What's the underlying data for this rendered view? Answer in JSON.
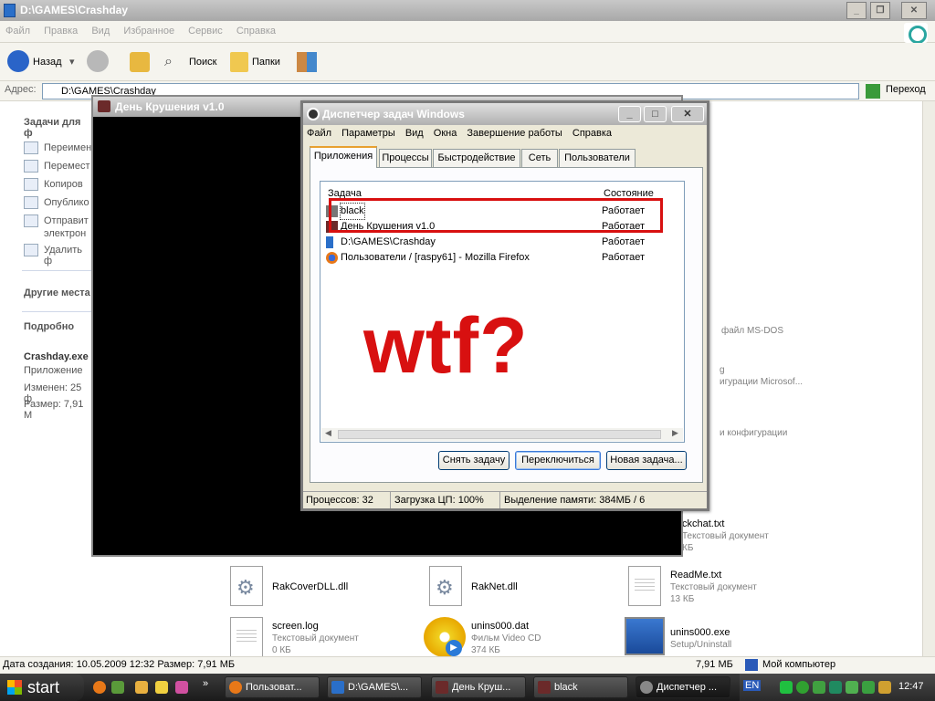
{
  "explorer": {
    "title": "D:\\GAMES\\Crashday",
    "menu": [
      "Файл",
      "Правка",
      "Вид",
      "Избранное",
      "Сервис",
      "Справка"
    ],
    "toolbar": {
      "back": "Назад",
      "search": "Поиск",
      "folders": "Папки"
    },
    "address_label": "Адрес:",
    "address_value": "D:\\GAMES\\Crashday",
    "go": "Переход",
    "taskpane": {
      "tasks_header": "Задачи для ф",
      "tasks": [
        "Переимен",
        "Перемест",
        "Копиров",
        "Опублико",
        "Отправит",
        "электрон",
        "Удалить ф"
      ],
      "other_header": "Другие места",
      "details_header": "Подробно",
      "detail_name": "Crashday.exe",
      "detail_type": "Приложение",
      "detail_modified": "Изменен: 25 ф",
      "detail_size": "Размер: 7,91 М"
    },
    "partial_labels": [
      "файл MS-DOS",
      "g",
      "игурации Microsof...",
      "и конфигурации"
    ],
    "files": [
      {
        "name": "ckchat.txt",
        "type": "Текстовый документ",
        "size": "КБ"
      },
      {
        "name": "RakCoverDLL.dll",
        "type": "",
        "size": ""
      },
      {
        "name": "RakNet.dll",
        "type": "",
        "size": ""
      },
      {
        "name": "ReadMe.txt",
        "type": "Текстовый документ",
        "size": "13 КБ"
      },
      {
        "name": "screen.log",
        "type": "Текстовый документ",
        "size": "0 КБ"
      },
      {
        "name": "unins000.dat",
        "type": "Фильм Video CD",
        "size": "374 КБ"
      },
      {
        "name": "unins000.exe",
        "type": "Setup/Uninstall",
        "size": ""
      }
    ],
    "status": {
      "left": "Дата создания: 10.05.2009 12:32 Размер: 7,91 МБ",
      "size": "7,91 МБ",
      "location": "Мой компьютер"
    }
  },
  "game_window": {
    "title": "День Крушения v1.0"
  },
  "task_manager": {
    "title": "Диспетчер задач Windows",
    "menu": [
      "Файл",
      "Параметры",
      "Вид",
      "Окна",
      "Завершение работы",
      "Справка"
    ],
    "tabs": [
      "Приложения",
      "Процессы",
      "Быстродействие",
      "Сеть",
      "Пользователи"
    ],
    "columns": {
      "task": "Задача",
      "state": "Состояние"
    },
    "rows": [
      {
        "name": "black",
        "state": "Работает"
      },
      {
        "name": "День Крушения v1.0",
        "state": "Работает"
      },
      {
        "name": "D:\\GAMES\\Crashday",
        "state": "Работает"
      },
      {
        "name": "Пользователи / [raspy61] - Mozilla Firefox",
        "state": "Работает"
      }
    ],
    "buttons": {
      "end": "Снять задачу",
      "switch": "Переключиться",
      "new": "Новая задача..."
    },
    "status": {
      "processes": "Процессов: 32",
      "cpu": "Загрузка ЦП: 100%",
      "memory": "Выделение памяти: 384МБ / 6"
    }
  },
  "annotation": "wtf?",
  "taskbar": {
    "start": "start",
    "buttons": [
      "Пользоват...",
      "D:\\GAMES\\...",
      "День Круш...",
      "black",
      "Диспетчер ..."
    ],
    "lang": "EN",
    "clock": "12:47"
  },
  "colors": {
    "annotation": "#d81010",
    "taskbar": "#2a2a2a"
  }
}
